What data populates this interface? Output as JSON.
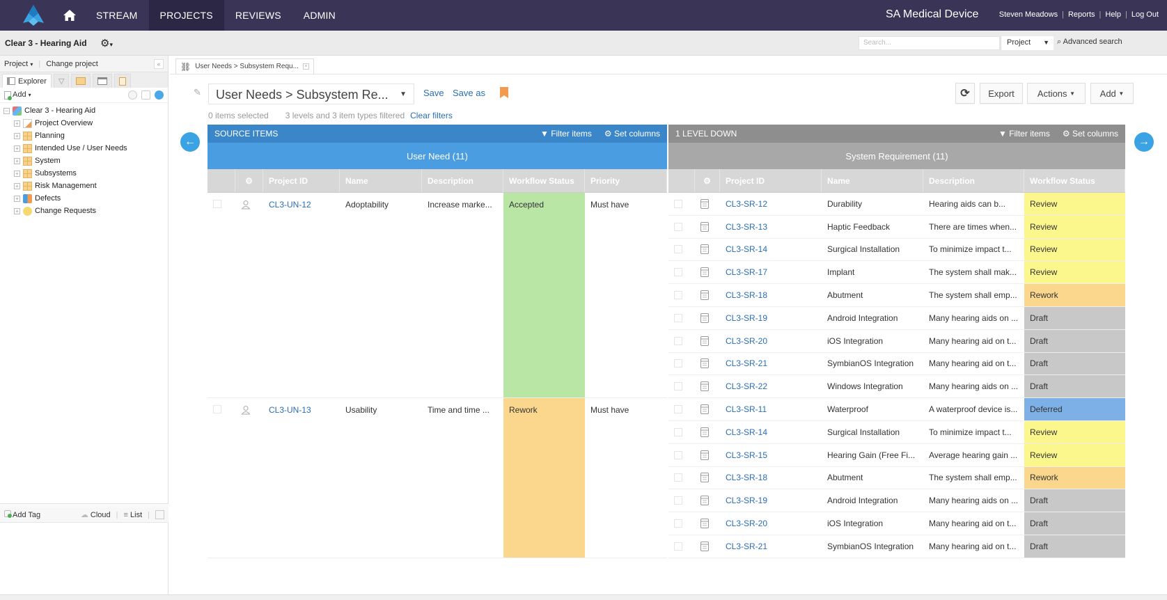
{
  "topnav": {
    "items": [
      {
        "label": "STREAM",
        "active": false
      },
      {
        "label": "PROJECTS",
        "active": true
      },
      {
        "label": "REVIEWS",
        "active": false
      },
      {
        "label": "ADMIN",
        "active": false
      }
    ],
    "org_name": "SA Medical Device",
    "user_links": [
      "Steven Meadows",
      "Reports",
      "Help",
      "Log Out"
    ]
  },
  "subbar": {
    "project_title": "Clear 3 - Hearing Aid",
    "search_placeholder": "Search...",
    "search_scope": "Project",
    "advanced_search": "Advanced search"
  },
  "sidebar": {
    "project_menu": "Project",
    "change_project": "Change project",
    "tabs": [
      {
        "label": "Explorer",
        "icon": "explorer-icon"
      },
      {
        "label": "",
        "icon": "filter-icon"
      },
      {
        "label": "",
        "icon": "grid-icon"
      },
      {
        "label": "",
        "icon": "window-icon"
      },
      {
        "label": "",
        "icon": "clipboard-icon"
      }
    ],
    "add_label": "Add",
    "tree_root": "Clear 3 - Hearing Aid",
    "tree_items": [
      {
        "label": "Project Overview",
        "icon": "overview-icon"
      },
      {
        "label": "Planning",
        "icon": "folder-grid-icon"
      },
      {
        "label": "Intended Use / User Needs",
        "icon": "folder-grid-icon"
      },
      {
        "label": "System",
        "icon": "folder-grid-icon"
      },
      {
        "label": "Subsystems",
        "icon": "folder-grid-icon"
      },
      {
        "label": "Risk Management",
        "icon": "folder-grid-icon"
      },
      {
        "label": "Defects",
        "icon": "defects-icon"
      },
      {
        "label": "Change Requests",
        "icon": "lightbulb-icon"
      }
    ],
    "tag_bar": {
      "add_tag": "Add Tag",
      "cloud": "Cloud",
      "list": "List"
    }
  },
  "main": {
    "doc_tab": "User Needs > Subsystem Requ...",
    "view_name": "User Needs > Subsystem Re...",
    "save": "Save",
    "save_as": "Save as",
    "items_selected": "0 items selected",
    "filter_status": "3 levels and 3 item types filtered",
    "clear_filters": "Clear filters",
    "buttons": {
      "export": "Export",
      "actions": "Actions",
      "add": "Add"
    },
    "colors": {
      "source_header": "#3a86c8",
      "source_sub": "#4a9de0",
      "target_header": "#8e8e8e",
      "target_sub": "#a8a8a8",
      "link": "#2a6db5"
    }
  },
  "source_panel": {
    "title": "SOURCE ITEMS",
    "filter_items": "Filter items",
    "set_columns": "Set columns",
    "item_type": "User Need (11)",
    "columns": [
      "Project ID",
      "Name",
      "Description",
      "Workflow Status",
      "Priority"
    ],
    "rows": [
      {
        "id": "CL3-UN-12",
        "name": "Adoptability",
        "description": "Increase marke...",
        "status": "Accepted",
        "status_color": "#b9e5a5",
        "priority": "Must have"
      },
      {
        "id": "CL3-UN-13",
        "name": "Usability",
        "description": "Time and time ...",
        "status": "Rework",
        "status_color": "#fad78c",
        "priority": "Must have"
      }
    ]
  },
  "target_panel": {
    "title": "1 LEVEL DOWN",
    "filter_items": "Filter items",
    "set_columns": "Set columns",
    "item_type": "System Requirement (11)",
    "columns": [
      "Project ID",
      "Name",
      "Description",
      "Workflow Status"
    ],
    "rows": [
      {
        "id": "CL3-SR-12",
        "name": "Durability",
        "description": "Hearing aids can b...",
        "status": "Review",
        "status_color": "#fbf78c"
      },
      {
        "id": "CL3-SR-13",
        "name": "Haptic Feedback",
        "description": "There are times when...",
        "status": "Review",
        "status_color": "#fbf78c"
      },
      {
        "id": "CL3-SR-14",
        "name": "Surgical Installation",
        "description": "To minimize impact t...",
        "status": "Review",
        "status_color": "#fbf78c"
      },
      {
        "id": "CL3-SR-17",
        "name": "Implant",
        "description": "The system shall mak...",
        "status": "Review",
        "status_color": "#fbf78c"
      },
      {
        "id": "CL3-SR-18",
        "name": "Abutment",
        "description": "The system shall emp...",
        "status": "Rework",
        "status_color": "#fad78c"
      },
      {
        "id": "CL3-SR-19",
        "name": "Android Integration",
        "description": "Many hearing aids on ...",
        "status": "Draft",
        "status_color": "#c8c8c8"
      },
      {
        "id": "CL3-SR-20",
        "name": "iOS Integration",
        "description": "Many hearing aid on t...",
        "status": "Draft",
        "status_color": "#c8c8c8"
      },
      {
        "id": "CL3-SR-21",
        "name": "SymbianOS Integration",
        "description": "Many hearing aid on t...",
        "status": "Draft",
        "status_color": "#c8c8c8"
      },
      {
        "id": "CL3-SR-22",
        "name": "Windows Integration",
        "description": "Many hearing aids on ...",
        "status": "Draft",
        "status_color": "#c8c8c8"
      },
      {
        "id": "CL3-SR-11",
        "name": "Waterproof",
        "description": "A waterproof device is...",
        "status": "Deferred",
        "status_color": "#7db0e6"
      },
      {
        "id": "CL3-SR-14",
        "name": "Surgical Installation",
        "description": "To minimize impact t...",
        "status": "Review",
        "status_color": "#fbf78c"
      },
      {
        "id": "CL3-SR-15",
        "name": "Hearing Gain (Free Fi...",
        "description": "Average hearing gain ...",
        "status": "Review",
        "status_color": "#fbf78c"
      },
      {
        "id": "CL3-SR-18",
        "name": "Abutment",
        "description": "The system shall emp...",
        "status": "Rework",
        "status_color": "#fad78c"
      },
      {
        "id": "CL3-SR-19",
        "name": "Android Integration",
        "description": "Many hearing aids on ...",
        "status": "Draft",
        "status_color": "#c8c8c8"
      },
      {
        "id": "CL3-SR-20",
        "name": "iOS Integration",
        "description": "Many hearing aid on t...",
        "status": "Draft",
        "status_color": "#c8c8c8"
      },
      {
        "id": "CL3-SR-21",
        "name": "SymbianOS Integration",
        "description": "Many hearing aid on t...",
        "status": "Draft",
        "status_color": "#c8c8c8"
      }
    ]
  }
}
